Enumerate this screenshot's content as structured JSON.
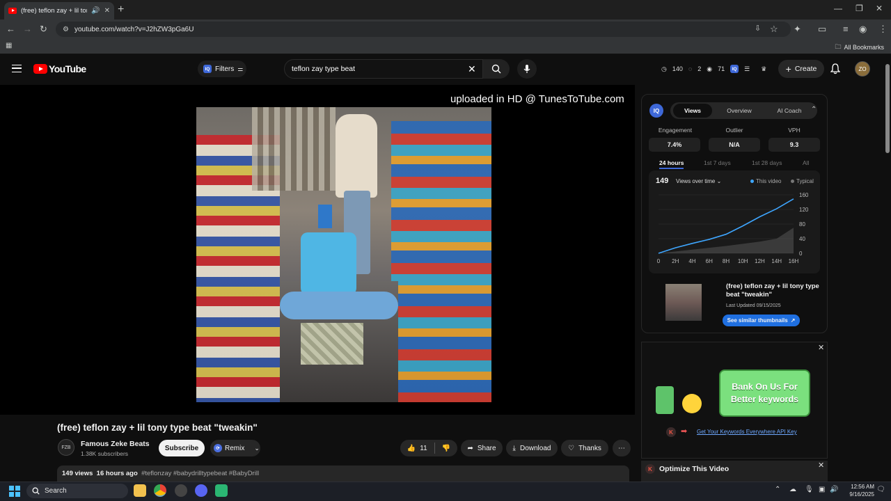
{
  "browser": {
    "tab_title": "(free) teflon zay + lil tony type beat \"tweakin\"",
    "url": "youtube.com/watch?v=J2hZW3pGa6U",
    "all_bookmarks": "All Bookmarks"
  },
  "header": {
    "logo_text": "YouTube",
    "filters_label": "Filters",
    "search_value": "teflon zay type beat",
    "stats": {
      "a": "140",
      "b": "2",
      "c": "71"
    },
    "create_label": "Create",
    "avatar_text": "ZO"
  },
  "player": {
    "overlay_text": "uploaded in HD @ TunesToTube.com"
  },
  "video": {
    "title": "(free) teflon zay + lil tony type beat \"tweakin\"",
    "channel_name": "Famous Zeke Beats",
    "channel_initials": "FZB",
    "subscribers": "1.38K subscribers",
    "subscribe_label": "Subscribe",
    "remix_label": "Remix",
    "like_count": "11",
    "share_label": "Share",
    "download_label": "Download",
    "thanks_label": "Thanks",
    "views": "149 views",
    "age": "16 hours ago",
    "hashtags": "#teflonzay #babydrilltypebeat #BabyDrill"
  },
  "iq_panel": {
    "tabs": [
      "Views",
      "Overview",
      "AI Coach"
    ],
    "active_tab": "Views",
    "metrics": [
      {
        "label": "Engagement",
        "value": "7.4%"
      },
      {
        "label": "Outlier",
        "value": "N/A"
      },
      {
        "label": "VPH",
        "value": "9.3"
      }
    ],
    "ranges": [
      "24 hours",
      "1st 7 days",
      "1st 28 days",
      "All"
    ],
    "active_range": "24 hours",
    "views_count": "149",
    "views_dropdown": "Views over time",
    "legend_this": "This video",
    "legend_typical": "Typical",
    "related": {
      "title": "(free) teflon zay + lil tony type beat \"tweakin\"",
      "updated": "Last Updated 09/15/2025",
      "button": "See similar thumbnails"
    }
  },
  "chart_data": {
    "type": "line",
    "x": [
      "0",
      "2H",
      "4H",
      "6H",
      "8H",
      "10H",
      "12H",
      "14H",
      "16H"
    ],
    "yticks": [
      0,
      40,
      80,
      120,
      160
    ],
    "ylim": [
      0,
      160
    ],
    "series": [
      {
        "name": "This video",
        "values": [
          0,
          15,
          27,
          38,
          52,
          75,
          100,
          122,
          149
        ]
      },
      {
        "name": "Typical",
        "values": [
          0,
          5,
          10,
          15,
          20,
          26,
          32,
          40,
          70
        ]
      }
    ],
    "colors": {
      "this": "#3ea6ff",
      "typical": "#555555"
    }
  },
  "ad": {
    "headline_1": "Bank On Us For",
    "headline_2": "Better keywords",
    "link": "Get Your Keywords Everywhere API Key"
  },
  "optimize": {
    "title": "Optimize This Video"
  },
  "taskbar": {
    "search_label": "Search",
    "time": "12:56 AM",
    "date": "9/16/2025"
  }
}
